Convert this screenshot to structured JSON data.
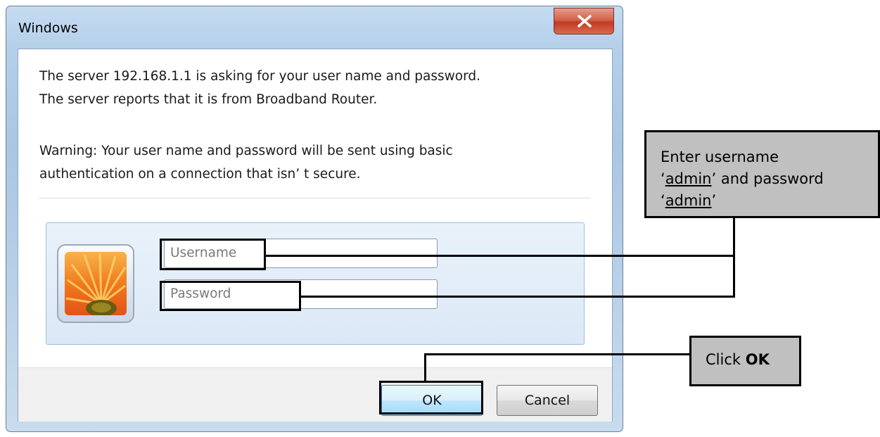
{
  "window": {
    "title": "Windows",
    "close_label": "close"
  },
  "message": {
    "line1": "The server 192.168.1.1 is asking for your user name and password.",
    "line2": "The server reports that it is from Broadband Router.",
    "warning_line1": "Warning: Your user name and password will be sent using basic",
    "warning_line2": "authentication on a connection that isn’ t secure."
  },
  "credentials": {
    "username_placeholder": "Username",
    "password_placeholder": "Password",
    "username_value": "",
    "password_value": "",
    "user_tile_icon": "user-avatar-flower-icon"
  },
  "buttons": {
    "ok_label": "OK",
    "cancel_label": "Cancel"
  },
  "annotations": {
    "credentials_note": {
      "line1": "Enter username",
      "quote_open": "‘",
      "username": "admin",
      "mid": "’ and password",
      "password": "admin",
      "quote_close": "’"
    },
    "ok_note": {
      "prefix": "Click ",
      "bold": "OK"
    }
  },
  "colors": {
    "close_button": "#c13b22",
    "callout_bg": "#c0c0c0",
    "panel_bg": "#e4eef8"
  }
}
